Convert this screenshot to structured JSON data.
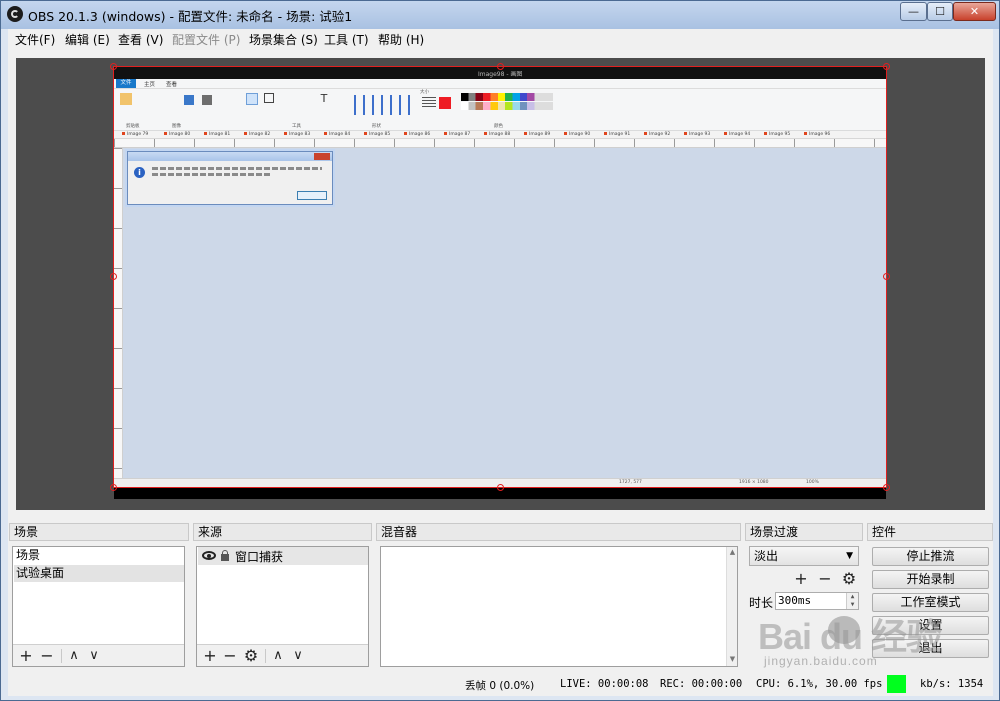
{
  "window": {
    "title": "OBS 20.1.3 (windows) - 配置文件: 未命名 - 场景: 试验1",
    "min_label": "—",
    "max_label": "☐",
    "close_label": "✕"
  },
  "menu": [
    {
      "label": "文件(F)",
      "enabled": true
    },
    {
      "label": "编辑 (E)",
      "enabled": true
    },
    {
      "label": "查看 (V)",
      "enabled": true
    },
    {
      "label": "配置文件 (P)",
      "enabled": false
    },
    {
      "label": "场景集合 (S)",
      "enabled": true
    },
    {
      "label": "工具 (T)",
      "enabled": true
    },
    {
      "label": "帮助 (H)",
      "enabled": true
    }
  ],
  "preview": {
    "paint_window_title": "Image98 - 画图",
    "paint_tabs": [
      "文件",
      "主页",
      "查看"
    ],
    "paint_doc_tabs": [
      "Image 79",
      "Image 80",
      "Image 81",
      "Image 82",
      "Image 83",
      "Image 84",
      "Image 85",
      "Image 86",
      "Image 87",
      "Image 88",
      "Image 89",
      "Image 90",
      "Image 91",
      "Image 92",
      "Image 93",
      "Image 94",
      "Image 95",
      "Image 96"
    ],
    "paint_groups": [
      "剪贴板",
      "图像",
      "工具",
      "形状",
      "大小",
      "颜色"
    ],
    "status_left": "1727, 577",
    "status_mid": "1916 × 1080",
    "status_zoom": "100%"
  },
  "scenes": {
    "title": "场景",
    "items": [
      {
        "label": "场景",
        "selected": false
      },
      {
        "label": "试验桌面",
        "selected": true
      }
    ]
  },
  "sources": {
    "title": "来源",
    "items": [
      {
        "label": "窗口捕获"
      }
    ]
  },
  "mixer": {
    "title": "混音器"
  },
  "transitions": {
    "title": "场景过渡",
    "selected": "淡出",
    "duration_label": "时长",
    "duration_value": "300ms"
  },
  "controls": {
    "title": "控件",
    "buttons": [
      "停止推流",
      "开始录制",
      "工作室模式",
      "设置",
      "退出"
    ]
  },
  "toolbar_icons": {
    "add": "+",
    "remove": "−",
    "gear": "⚙",
    "up": "∧",
    "down": "∨"
  },
  "status": {
    "dropped_frames": "丢帧 0 (0.0%)",
    "live": "LIVE: 00:00:08",
    "rec": "REC: 00:00:00",
    "cpu": "CPU: 6.1%, 30.00 fps",
    "kbps": "kb/s: 1354",
    "health_color": "#00ff1e"
  },
  "watermark": {
    "text": "Bai du 经验",
    "sub": "jingyan.baidu.com"
  }
}
